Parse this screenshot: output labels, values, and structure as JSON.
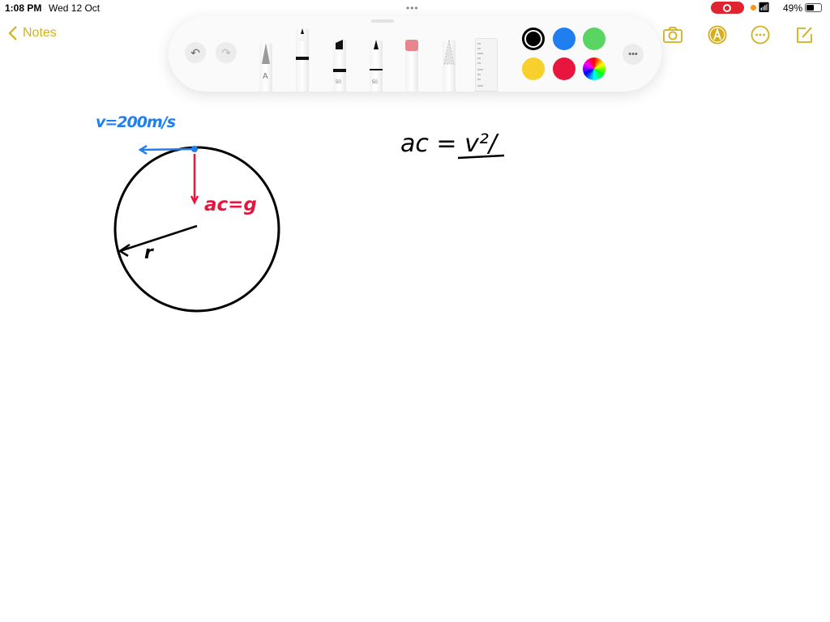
{
  "status_bar": {
    "time": "1:08 PM",
    "date": "Wed 12 Oct",
    "battery": "49%",
    "battery_level": 49
  },
  "nav": {
    "back_label": "Notes"
  },
  "toolbar": {
    "tools": [
      "pen",
      "marker",
      "highlighter",
      "fineliner",
      "eraser",
      "lasso",
      "ruler"
    ],
    "highlighter_size": "50",
    "fineliner_size": "50",
    "pen_label": "A",
    "colors": [
      "#000000",
      "#1f7ef0",
      "#5ad563",
      "#f7d02c",
      "#e8163e",
      "color-wheel"
    ],
    "selected_color": "#000000"
  },
  "right_icons": [
    "camera-icon",
    "markup-icon",
    "more-icon",
    "compose-icon"
  ],
  "accent": "#d4b01c",
  "drawing": {
    "velocity_label": "v=200m/s",
    "accel_label": "ac=g",
    "radius_label": "r",
    "formula": "ac = v²/"
  }
}
